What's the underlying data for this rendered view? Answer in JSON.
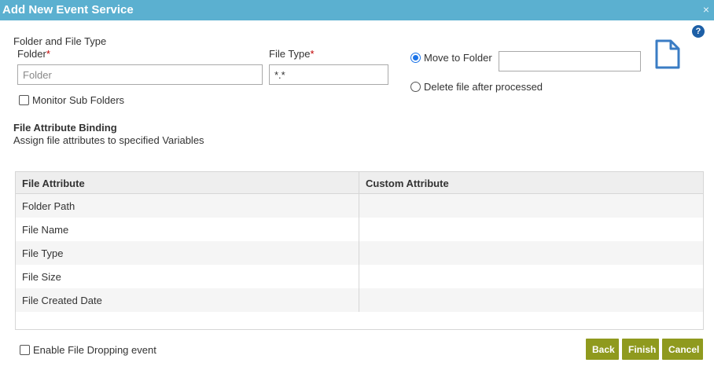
{
  "dialog": {
    "title": "Add New Event Service",
    "close_glyph": "×",
    "help_glyph": "?"
  },
  "folder_section": {
    "heading": "Folder and File Type",
    "folder_label": "Folder",
    "required_mark": "*",
    "folder_placeholder": "Folder",
    "filetype_label": "File Type",
    "filetype_value": "*.*",
    "monitor_subfolders_label": "Monitor Sub Folders",
    "move_to_folder_label": "Move to Folder",
    "move_to_folder_value": "",
    "delete_after_label": "Delete file after processed",
    "selected_option": "move_to_folder"
  },
  "binding": {
    "title": "File Attribute Binding",
    "subtitle": "Assign file attributes to specified Variables",
    "columns": [
      "File Attribute",
      "Custom Attribute"
    ],
    "rows": [
      {
        "attribute": "Folder Path",
        "custom": ""
      },
      {
        "attribute": "File Name",
        "custom": ""
      },
      {
        "attribute": "File Type",
        "custom": ""
      },
      {
        "attribute": "File Size",
        "custom": ""
      },
      {
        "attribute": "File Created Date",
        "custom": ""
      }
    ]
  },
  "footer": {
    "enable_dropping_label": "Enable File Dropping event",
    "back_label": "Back",
    "finish_label": "Finish",
    "cancel_label": "Cancel"
  },
  "colors": {
    "titlebar": "#5bb0d0",
    "button": "#8f9a1e",
    "accent": "#1a73e8",
    "help": "#1d5fa6",
    "required": "#c00000"
  }
}
